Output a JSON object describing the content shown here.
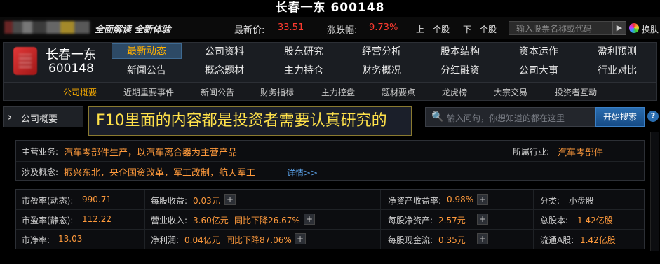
{
  "title": "长春一东 600148",
  "quotebar": {
    "slogan": "全面解读 全新体验",
    "latest_price_label": "最新价:",
    "latest_price": "33.51",
    "change_label": "涨跌幅:",
    "change": "9.73%",
    "prev_stock": "上一个股",
    "next_stock": "下一个股",
    "search_placeholder": "输入股票名称或代码",
    "skin_label": "换肤",
    "price_color": "#ff3b30"
  },
  "stock": {
    "name": "长春一东",
    "code": "600148"
  },
  "nav": {
    "row1": [
      "最新动态",
      "公司资料",
      "股东研究",
      "经营分析",
      "股本结构",
      "资本运作",
      "盈利预测"
    ],
    "row2": [
      "新闻公告",
      "概念题材",
      "主力持仓",
      "财务概况",
      "分红融资",
      "公司大事",
      "行业对比"
    ],
    "active": "最新动态",
    "sub": [
      "公司概要",
      "近期重要事件",
      "新闻公告",
      "财务指标",
      "主力控盘",
      "题材要点",
      "龙虎榜",
      "大宗交易",
      "投资者互动"
    ],
    "sub_active": "公司概要",
    "accent_color": "#ffb000"
  },
  "section": {
    "tab_label": "公司概要",
    "tip": "F10里面的内容都是投资者需要认真研究的",
    "search_placeholder": "输入问句，你想知道的都在这里",
    "search_button": "开始搜索"
  },
  "info": {
    "business_label": "主营业务:",
    "business": "汽车零部件生产，以汽车离合器为主营产品",
    "industry_label": "所属行业:",
    "industry": "汽车零部件",
    "concept_label": "涉及概念:",
    "concepts": "振兴东北，央企国资改革，军工改制，航天军工",
    "detail_link": "详情>>"
  },
  "metrics": {
    "rows": [
      [
        {
          "label": "市盈率(动态):",
          "value": "990.71"
        },
        {
          "label": "每股收益:",
          "value": "0.03元"
        },
        {
          "label": "净资产收益率:",
          "value": "0.98%"
        },
        {
          "label": "分类:",
          "value": "小盘股"
        }
      ],
      [
        {
          "label": "市盈率(静态):",
          "value": "112.22"
        },
        {
          "label": "营业收入:",
          "value": "3.60亿元",
          "extra": "同比下降26.67%"
        },
        {
          "label": "每股净资产:",
          "value": "2.57元"
        },
        {
          "label": "总股本:",
          "value": "1.42亿股"
        }
      ],
      [
        {
          "label": "市净率:",
          "value": "13.03"
        },
        {
          "label": "净利润:",
          "value": "0.04亿元",
          "extra": "同比下降87.06%"
        },
        {
          "label": "每股现金流:",
          "value": "0.35元"
        },
        {
          "label": "流通A股:",
          "value": "1.42亿股"
        }
      ]
    ],
    "value_color": "#ff9a3c"
  }
}
